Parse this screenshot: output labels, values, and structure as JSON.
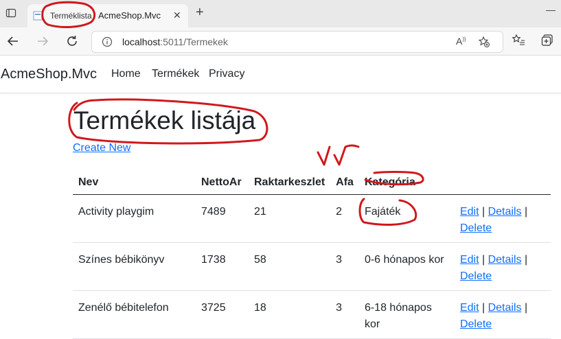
{
  "browser": {
    "tab": {
      "title_annotated": "Terméklista",
      "title": "AcmeShop.Mvc",
      "close_glyph": "✕"
    },
    "new_tab_glyph": "+",
    "minimize_glyph": "—",
    "address": {
      "host": "localhost",
      "path": ":5011/Termekek"
    },
    "read_aloud_label": "Aᴬ"
  },
  "site": {
    "brand": "AcmeShop.Mvc",
    "nav": [
      "Home",
      "Termékek",
      "Privacy"
    ]
  },
  "page": {
    "title": "Termékek listája",
    "create_link": "Create New"
  },
  "table": {
    "headers": [
      "Nev",
      "NettoAr",
      "Raktarkeszlet",
      "Afa",
      "Kategória",
      ""
    ],
    "rows": [
      {
        "nev": "Activity playgim",
        "nettoar": "7489",
        "raktar": "21",
        "afa": "2",
        "kategoria": "Fajáték"
      },
      {
        "nev": "Színes bébikönyv",
        "nettoar": "1738",
        "raktar": "58",
        "afa": "3",
        "kategoria": "0-6 hónapos kor"
      },
      {
        "nev": "Zenélő bébitelefon",
        "nettoar": "3725",
        "raktar": "18",
        "afa": "3",
        "kategoria": "6-18 hónapos kor"
      }
    ],
    "actions": {
      "edit": "Edit",
      "details": "Details",
      "delete": "Delete",
      "sep": "|"
    }
  },
  "annotation": {
    "handwritten_mark": "√√",
    "color": "#d0181c"
  },
  "colors": {
    "link": "#0d6efd",
    "text": "#212529"
  }
}
